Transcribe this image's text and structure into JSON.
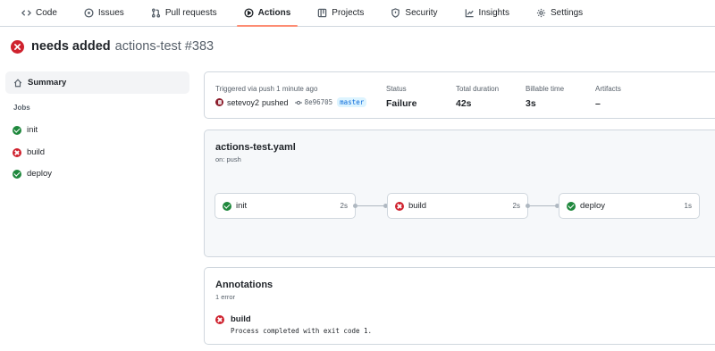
{
  "nav": {
    "tabs": [
      {
        "label": "Code",
        "icon": "code-icon"
      },
      {
        "label": "Issues",
        "icon": "issue-icon"
      },
      {
        "label": "Pull requests",
        "icon": "pull-request-icon"
      },
      {
        "label": "Actions",
        "icon": "play-icon",
        "active": true
      },
      {
        "label": "Projects",
        "icon": "table-icon"
      },
      {
        "label": "Security",
        "icon": "shield-icon"
      },
      {
        "label": "Insights",
        "icon": "graph-icon"
      },
      {
        "label": "Settings",
        "icon": "gear-icon"
      }
    ]
  },
  "run": {
    "title": "needs added",
    "workflow_ref": "actions-test #383",
    "status_icon": "x-circle-icon"
  },
  "sidebar": {
    "summary_label": "Summary",
    "jobs_heading": "Jobs",
    "jobs": [
      {
        "label": "init",
        "status": "success"
      },
      {
        "label": "build",
        "status": "failure"
      },
      {
        "label": "deploy",
        "status": "success"
      }
    ]
  },
  "info": {
    "triggered": "Triggered via push 1 minute ago",
    "actor": "setevoy2",
    "action": "pushed",
    "commit": "8e96705",
    "branch": "master",
    "status_label": "Status",
    "status_value": "Failure",
    "duration_label": "Total duration",
    "duration_value": "42s",
    "billable_label": "Billable time",
    "billable_value": "3s",
    "artifacts_label": "Artifacts",
    "artifacts_value": "–"
  },
  "graph": {
    "workflow_file": "actions-test.yaml",
    "trigger": "on: push",
    "jobs": [
      {
        "label": "init",
        "duration": "2s",
        "status": "success"
      },
      {
        "label": "build",
        "duration": "2s",
        "status": "failure"
      },
      {
        "label": "deploy",
        "duration": "1s",
        "status": "success"
      }
    ]
  },
  "annotations": {
    "title": "Annotations",
    "count": "1 error",
    "items": [
      {
        "job": "build",
        "message": "Process completed with exit code 1."
      }
    ]
  },
  "colors": {
    "success": "#1f883d",
    "failure": "#cf222e",
    "active_tab_underline": "#fd8c73",
    "branch_bg": "#ddf4ff",
    "branch_text": "#0969da"
  }
}
